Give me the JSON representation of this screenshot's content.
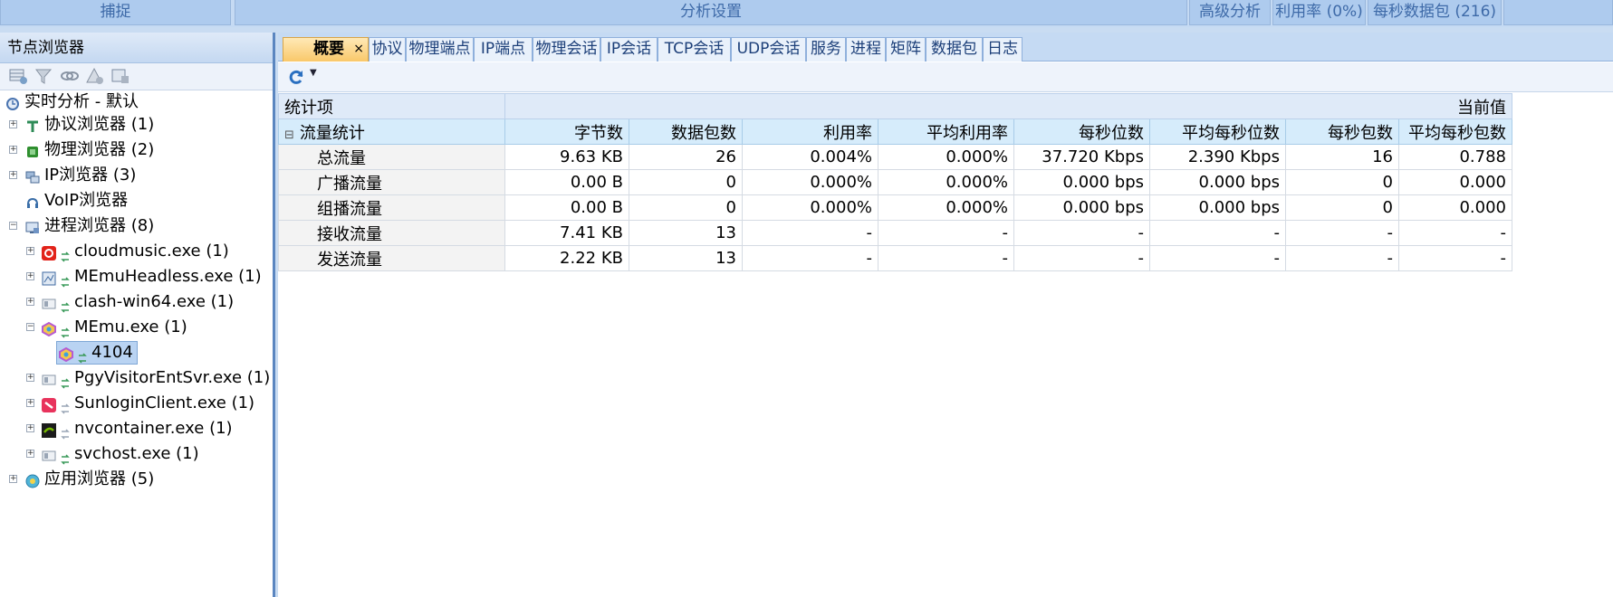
{
  "top_bar": {
    "capture": "捕捉",
    "analysis_settings": "分析设置",
    "advanced_analysis": "高级分析",
    "utilization": "利用率 (0%)",
    "packets_per_sec": "每秒数据包 (216)"
  },
  "node_browser": {
    "title": "节点浏览器",
    "toolbar_icons": [
      "add-node-icon",
      "filter-icon",
      "link-icon",
      "alert-icon",
      "export-icon"
    ],
    "root": "实时分析 - 默认",
    "items": [
      {
        "label": "协议浏览器 (1)",
        "icon": "protocol-icon"
      },
      {
        "label": "物理浏览器 (2)",
        "icon": "physical-icon"
      },
      {
        "label": "IP浏览器 (3)",
        "icon": "ip-icon"
      },
      {
        "label": "VoIP浏览器",
        "icon": "voip-icon"
      },
      {
        "label": "进程浏览器 (8)",
        "icon": "process-icon"
      }
    ],
    "processes": [
      {
        "label": "cloudmusic.exe (1)",
        "icon": "cloudmusic-icon"
      },
      {
        "label": "MEmuHeadless.exe (1)",
        "icon": "memu-headless-icon"
      },
      {
        "label": "clash-win64.exe (1)",
        "icon": "app-window-icon"
      },
      {
        "label": "MEmu.exe (1)",
        "icon": "memu-icon"
      },
      {
        "label": "4104",
        "icon": "memu-icon",
        "selected": true
      },
      {
        "label": "PgyVisitorEntSvr.exe (1)",
        "icon": "app-window-icon"
      },
      {
        "label": "SunloginClient.exe (1)",
        "icon": "sunlogin-icon"
      },
      {
        "label": "nvcontainer.exe (1)",
        "icon": "nvidia-icon"
      },
      {
        "label": "svchost.exe (1)",
        "icon": "app-window-icon"
      }
    ],
    "apps": {
      "label": "应用浏览器 (5)",
      "icon": "app-browser-icon"
    }
  },
  "tabs": [
    {
      "label": "概要",
      "active": true,
      "close": "×"
    },
    {
      "label": "协议"
    },
    {
      "label": "物理端点"
    },
    {
      "label": "IP端点"
    },
    {
      "label": "物理会话"
    },
    {
      "label": "IP会话"
    },
    {
      "label": "TCP会话"
    },
    {
      "label": "UDP会话"
    },
    {
      "label": "服务"
    },
    {
      "label": "进程"
    },
    {
      "label": "矩阵"
    },
    {
      "label": "数据包"
    },
    {
      "label": "日志"
    }
  ],
  "table": {
    "stat_item": "统计项",
    "current_value": "当前值",
    "group": "流量统计",
    "group_toggle": "⊟",
    "columns": [
      "字节数",
      "数据包数",
      "利用率",
      "平均利用率",
      "每秒位数",
      "平均每秒位数",
      "每秒包数",
      "平均每秒包数"
    ],
    "rows": [
      {
        "name": "总流量",
        "cells": [
          "9.63 KB",
          "26",
          "0.004%",
          "0.000%",
          "37.720 Kbps",
          "2.390 Kbps",
          "16",
          "0.788"
        ]
      },
      {
        "name": "广播流量",
        "cells": [
          "0.00 B",
          "0",
          "0.000%",
          "0.000%",
          "0.000 bps",
          "0.000 bps",
          "0",
          "0.000"
        ]
      },
      {
        "name": "组播流量",
        "cells": [
          "0.00 B",
          "0",
          "0.000%",
          "0.000%",
          "0.000 bps",
          "0.000 bps",
          "0",
          "0.000"
        ]
      },
      {
        "name": "接收流量",
        "cells": [
          "7.41 KB",
          "13",
          "-",
          "-",
          "-",
          "-",
          "-",
          "-"
        ]
      },
      {
        "name": "发送流量",
        "cells": [
          "2.22 KB",
          "13",
          "-",
          "-",
          "-",
          "-",
          "-",
          "-"
        ]
      }
    ]
  },
  "colors": {
    "accent": "#5b86c0",
    "tab_active": "#f9c86a",
    "header_bg": "#c5daf3"
  }
}
